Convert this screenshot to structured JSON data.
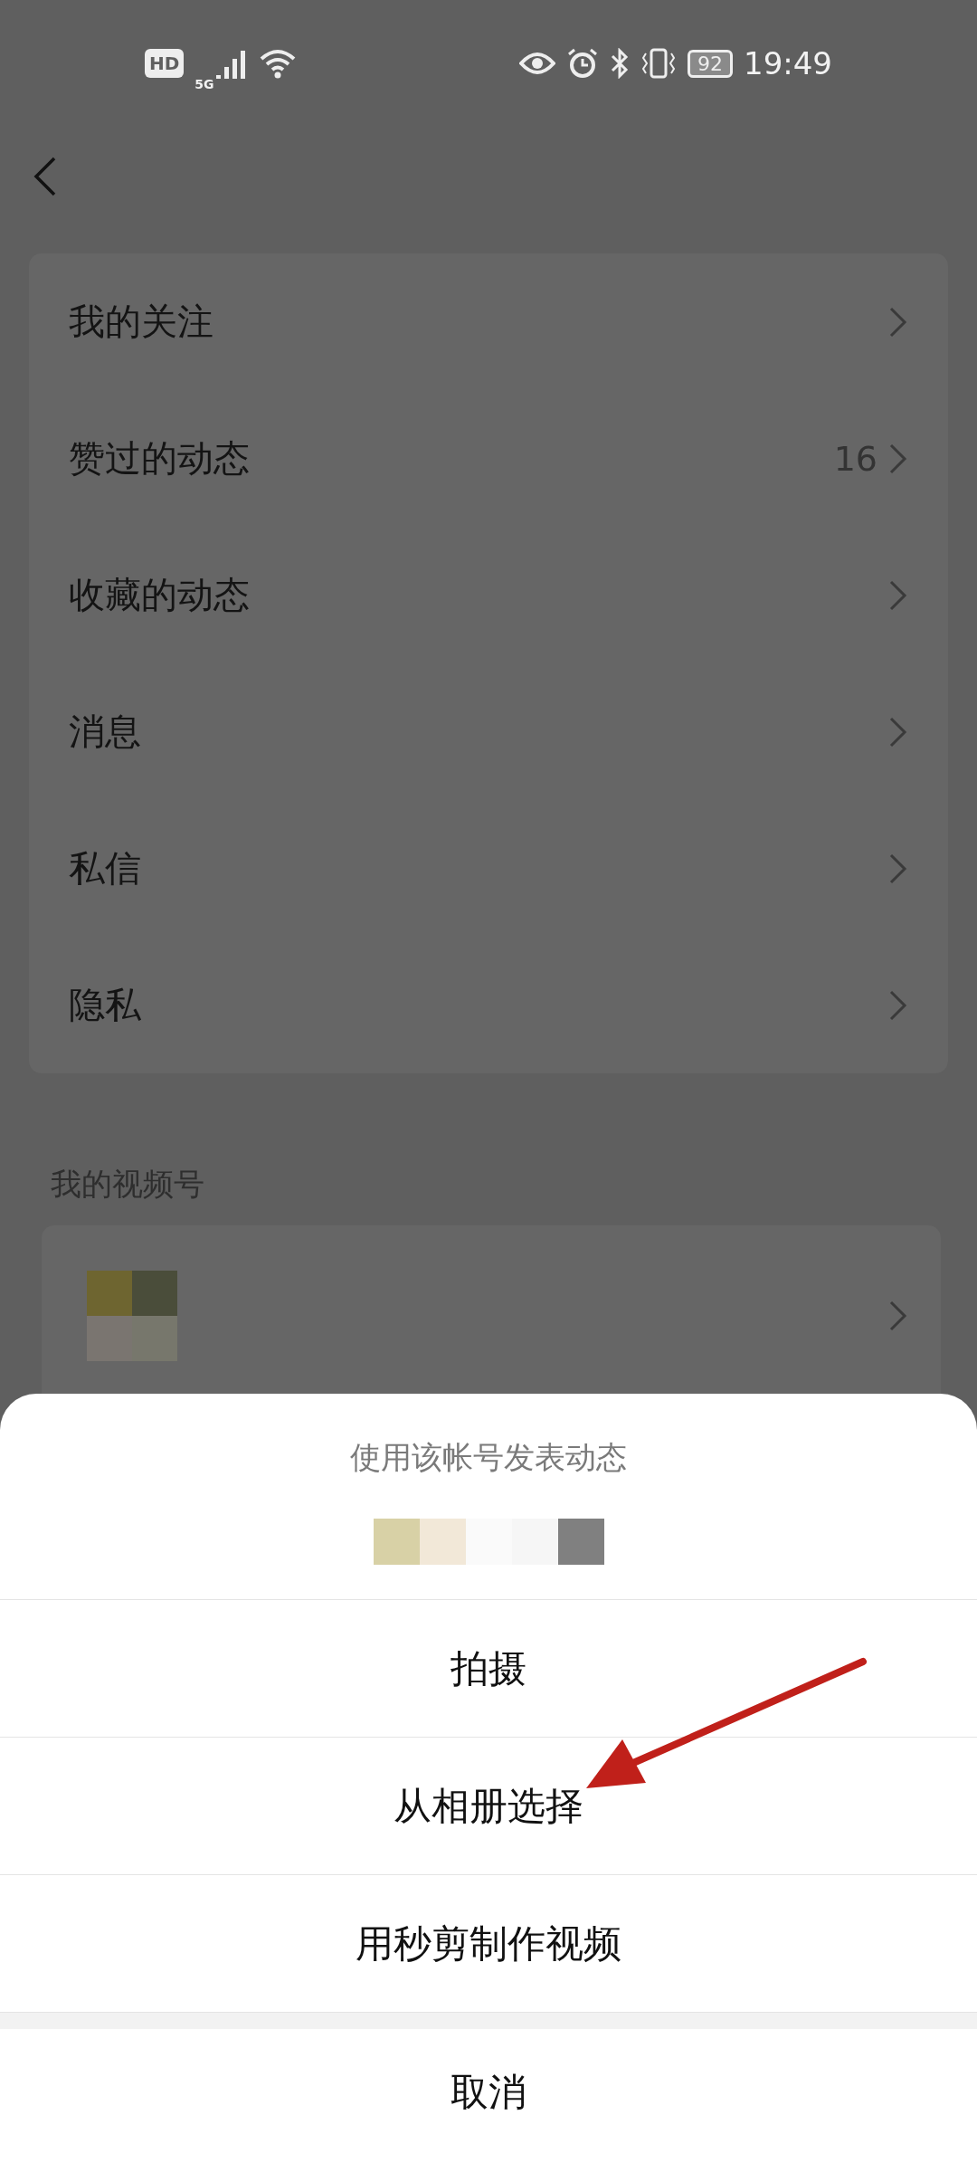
{
  "status_bar": {
    "hd": "HD",
    "network": "5G",
    "battery": "92",
    "time": "19:49"
  },
  "menu_items": [
    {
      "label": "我的关注"
    },
    {
      "label": "赞过的动态",
      "count": "16"
    },
    {
      "label": "收藏的动态"
    },
    {
      "label": "消息"
    },
    {
      "label": "私信"
    },
    {
      "label": "隐私"
    }
  ],
  "video_section": {
    "title": "我的视频号"
  },
  "sheet": {
    "title": "使用该帐号发表动态",
    "options": [
      "拍摄",
      "从相册选择",
      "用秒剪制作视频"
    ],
    "cancel": "取消"
  }
}
